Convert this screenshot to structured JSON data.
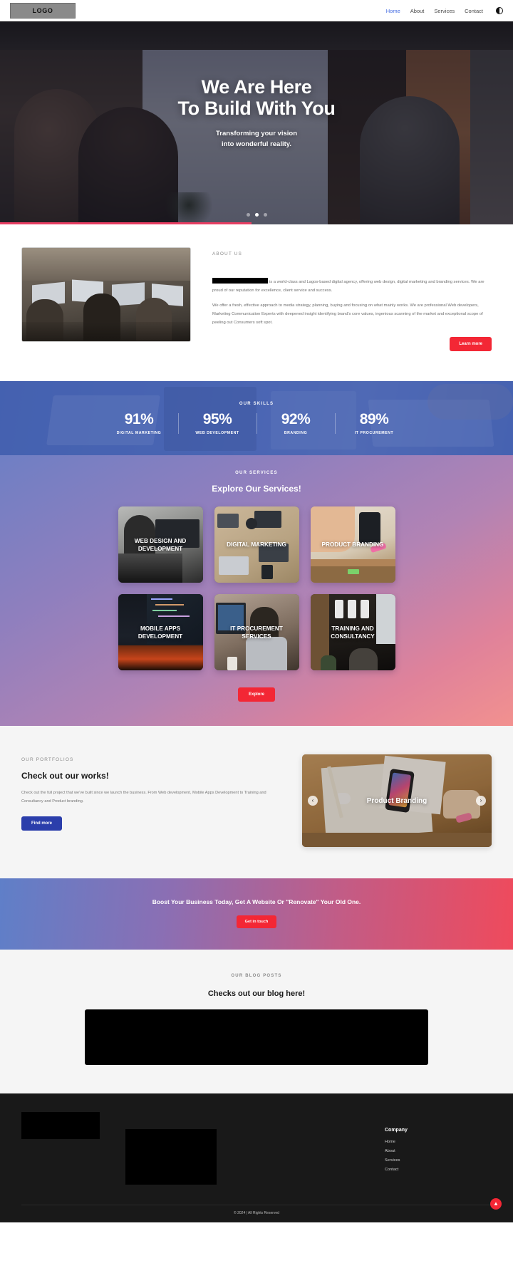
{
  "nav": {
    "logo": "LOGO",
    "links": [
      {
        "label": "Home",
        "active": true
      },
      {
        "label": "About",
        "active": false
      },
      {
        "label": "Services",
        "active": false
      },
      {
        "label": "Contact",
        "active": false
      }
    ],
    "theme_toggle_icon": "half-circle-icon"
  },
  "hero": {
    "title_line1": "We Are Here",
    "title_line2": "To Build With You",
    "subtitle_line1": "Transforming your vision",
    "subtitle_line2": "into wonderful reality.",
    "slides_total": 3,
    "active_slide": 2,
    "progress_percent": 49,
    "progress_color": "#e83e63"
  },
  "about": {
    "eyebrow": "ABOUT US",
    "paragraph1_redacted": true,
    "paragraph1": "is a world-class and Lagos-based digital agency, offering web design, digital marketing and branding services. We are proud of our reputation for excellence, client service and success.",
    "paragraph2": "We offer a fresh, effective approach to media strategy, planning, buying and focusing on what mainly works. We are professional Web developers, Marketing Communication Experts with deepened insight identifying brand's core values, ingenious scanning of the market and exceptional scope of peeling out Consumers soft spot.",
    "button_label": "Learn more",
    "button_color": "#f32735"
  },
  "skills": {
    "eyebrow": "OUR SKILLS",
    "items": [
      {
        "value": "91%",
        "label": "DIGITAL MARKETING"
      },
      {
        "value": "95%",
        "label": "WEB DEVELOPMENT"
      },
      {
        "value": "92%",
        "label": "BRANDING"
      },
      {
        "value": "89%",
        "label": "IT PROCUREMENT"
      }
    ]
  },
  "services": {
    "eyebrow": "OUR SERVICES",
    "title": "Explore Our Services!",
    "cards": [
      {
        "label": "WEB DESIGN AND DEVELOPMENT"
      },
      {
        "label": "DIGITAL MARKETING"
      },
      {
        "label": "PRODUCT BRANDING"
      },
      {
        "label": "MOBILE APPS DEVELOPMENT"
      },
      {
        "label": "IT PROCUREMENT SERVICES"
      },
      {
        "label": "TRAINING AND CONSULTANCY"
      }
    ],
    "button_label": "Explore",
    "button_color": "#f32735"
  },
  "portfolio": {
    "eyebrow": "OUR PORTFOLIOS",
    "title": "Check out our works!",
    "description": "Check out the full project that we've built since we launch the business. From Web development, Mobile Apps Development to Training and Consultancy and Product branding.",
    "button_label": "Find more",
    "button_color": "#2b3eab",
    "slide_caption": "Product Branding",
    "prev_icon": "chevron-left-icon",
    "next_icon": "chevron-right-icon"
  },
  "cta": {
    "text": "Boost Your Business Today, Get A Website Or \"Renovate\" Your Old One.",
    "button_label": "Get in touch",
    "button_color": "#f32735"
  },
  "blog": {
    "eyebrow": "OUR BLOG POSTS",
    "title": "Checks out our blog here!"
  },
  "footer": {
    "heading": "Company",
    "links": [
      "Home",
      "About",
      "Services",
      "Contact"
    ],
    "copyright": "© 2024 | All Rights Reserved",
    "scroll_top_icon": "arrow-up-icon"
  }
}
